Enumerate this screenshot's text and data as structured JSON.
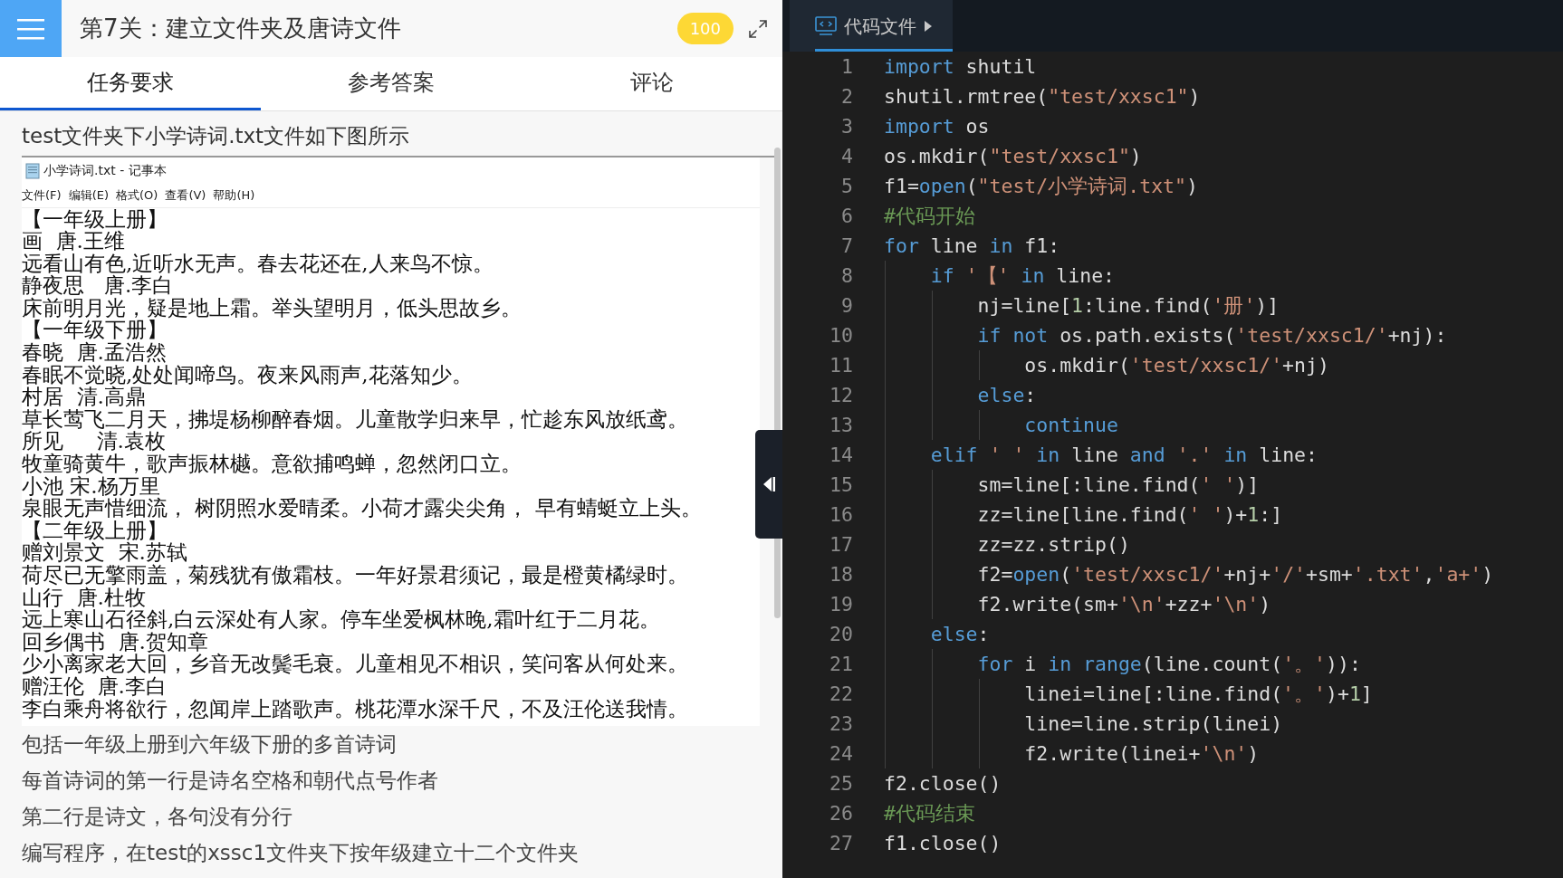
{
  "header": {
    "title": "第7关：建立文件夹及唐诗文件",
    "score": "100"
  },
  "tabs": [
    {
      "label": "任务要求",
      "selected": true
    },
    {
      "label": "参考答案",
      "selected": false
    },
    {
      "label": "评论",
      "selected": false
    }
  ],
  "content": {
    "heading": "test文件夹下小学诗词.txt文件如下图所示",
    "notepad": {
      "title": "小学诗词.txt - 记事本",
      "menu": [
        "文件(F)",
        "编辑(E)",
        "格式(O)",
        "查看(V)",
        "帮助(H)"
      ],
      "lines": [
        "【一年级上册】",
        "画  唐.王维",
        "远看山有色,近听水无声。春去花还在,人来鸟不惊。",
        "静夜思   唐.李白",
        "床前明月光，疑是地上霜。举头望明月，低头思故乡。",
        "【一年级下册】",
        "春晓  唐.孟浩然",
        "春眠不觉晓,处处闻啼鸟。夜来风雨声,花落知少。",
        "村居  清.高鼎",
        "草长莺飞二月天，拂堤杨柳醉春烟。儿童散学归来早，忙趁东风放纸鸢。",
        "所见     清.袁枚",
        "牧童骑黄牛，歌声振林樾。意欲捕鸣蝉，忽然闭口立。",
        "小池 宋.杨万里",
        "泉眼无声惜细流， 树阴照水爱晴柔。小荷才露尖尖角， 早有蜻蜓立上头。",
        "【二年级上册】",
        "赠刘景文  宋.苏轼",
        "荷尽已无擎雨盖，菊残犹有傲霜枝。一年好景君须记，最是橙黄橘绿时。",
        "山行  唐.杜牧",
        "远上寒山石径斜,白云深处有人家。停车坐爱枫林晚,霜叶红于二月花。",
        "回乡偶书  唐.贺知章",
        "少小离家老大回，乡音无改鬓毛衰。儿童相见不相识，笑问客从何处来。",
        "赠汪伦  唐.李白",
        "李白乘舟将欲行，忽闻岸上踏歌声。桃花潭水深千尺，不及汪伦送我情。"
      ]
    },
    "paragraphs": [
      "包括一年级上册到六年级下册的多首诗词",
      "每首诗词的第一行是诗名空格和朝代点号作者",
      "第二行是诗文，各句没有分行",
      "编写程序，在test的xssc1文件夹下按年级建立十二个文件夹"
    ]
  },
  "editor": {
    "tab": "代码文件",
    "lines": [
      {
        "number": "1",
        "tokens": [
          {
            "kind": "keyword",
            "text": "import"
          },
          {
            "kind": "plain",
            "text": " shutil"
          }
        ]
      },
      {
        "number": "2",
        "tokens": [
          {
            "kind": "plain",
            "text": "shutil.rmtree("
          },
          {
            "kind": "string",
            "text": "\"test/xxsc1\""
          },
          {
            "kind": "plain",
            "text": ")"
          }
        ]
      },
      {
        "number": "3",
        "tokens": [
          {
            "kind": "keyword",
            "text": "import"
          },
          {
            "kind": "plain",
            "text": " os"
          }
        ]
      },
      {
        "number": "4",
        "tokens": [
          {
            "kind": "plain",
            "text": "os.mkdir("
          },
          {
            "kind": "string",
            "text": "\"test/xxsc1\""
          },
          {
            "kind": "plain",
            "text": ")"
          }
        ]
      },
      {
        "number": "5",
        "tokens": [
          {
            "kind": "plain",
            "text": "f1="
          },
          {
            "kind": "keyword",
            "text": "open"
          },
          {
            "kind": "plain",
            "text": "("
          },
          {
            "kind": "string",
            "text": "\"test/小学诗词.txt\""
          },
          {
            "kind": "plain",
            "text": ")"
          }
        ]
      },
      {
        "number": "6",
        "tokens": [
          {
            "kind": "comment",
            "text": "#代码开始"
          }
        ]
      },
      {
        "number": "7",
        "tokens": [
          {
            "kind": "keyword",
            "text": "for"
          },
          {
            "kind": "plain",
            "text": " line "
          },
          {
            "kind": "keyword",
            "text": "in"
          },
          {
            "kind": "plain",
            "text": " f1:"
          }
        ]
      },
      {
        "number": "8",
        "tokens": [
          {
            "kind": "keyword",
            "text": "    if"
          },
          {
            "kind": "string",
            "text": " '【'"
          },
          {
            "kind": "keyword",
            "text": " in"
          },
          {
            "kind": "plain",
            "text": " line:"
          }
        ]
      },
      {
        "number": "9",
        "tokens": [
          {
            "kind": "plain",
            "text": "        nj=line["
          },
          {
            "kind": "number",
            "text": "1"
          },
          {
            "kind": "plain",
            "text": ":line.find("
          },
          {
            "kind": "string",
            "text": "'册'"
          },
          {
            "kind": "plain",
            "text": ")]"
          }
        ]
      },
      {
        "number": "10",
        "tokens": [
          {
            "kind": "keyword",
            "text": "        if"
          },
          {
            "kind": "keyword",
            "text": " not"
          },
          {
            "kind": "plain",
            "text": " os.path.exists("
          },
          {
            "kind": "string",
            "text": "'test/xxsc1/'"
          },
          {
            "kind": "plain",
            "text": "+nj):"
          }
        ]
      },
      {
        "number": "11",
        "tokens": [
          {
            "kind": "plain",
            "text": "            os.mkdir("
          },
          {
            "kind": "string",
            "text": "'test/xxsc1/'"
          },
          {
            "kind": "plain",
            "text": "+nj)"
          }
        ]
      },
      {
        "number": "12",
        "tokens": [
          {
            "kind": "keyword",
            "text": "        else"
          },
          {
            "kind": "plain",
            "text": ":"
          }
        ]
      },
      {
        "number": "13",
        "tokens": [
          {
            "kind": "keyword",
            "text": "            continue"
          }
        ]
      },
      {
        "number": "14",
        "tokens": [
          {
            "kind": "keyword",
            "text": "    elif"
          },
          {
            "kind": "string",
            "text": " ' '"
          },
          {
            "kind": "keyword",
            "text": " in"
          },
          {
            "kind": "plain",
            "text": " line "
          },
          {
            "kind": "keyword",
            "text": "and"
          },
          {
            "kind": "string",
            "text": " '.'"
          },
          {
            "kind": "keyword",
            "text": " in"
          },
          {
            "kind": "plain",
            "text": " line:"
          }
        ]
      },
      {
        "number": "15",
        "tokens": [
          {
            "kind": "plain",
            "text": "        sm=line[:line.find("
          },
          {
            "kind": "string",
            "text": "' '"
          },
          {
            "kind": "plain",
            "text": ")]"
          }
        ]
      },
      {
        "number": "16",
        "tokens": [
          {
            "kind": "plain",
            "text": "        zz=line[line.find("
          },
          {
            "kind": "string",
            "text": "' '"
          },
          {
            "kind": "plain",
            "text": ")+"
          },
          {
            "kind": "number",
            "text": "1"
          },
          {
            "kind": "plain",
            "text": ":]"
          }
        ]
      },
      {
        "number": "17",
        "tokens": [
          {
            "kind": "plain",
            "text": "        zz=zz.strip()"
          }
        ]
      },
      {
        "number": "18",
        "tokens": [
          {
            "kind": "plain",
            "text": "        f2="
          },
          {
            "kind": "keyword",
            "text": "open"
          },
          {
            "kind": "plain",
            "text": "("
          },
          {
            "kind": "string",
            "text": "'test/xxsc1/'"
          },
          {
            "kind": "plain",
            "text": "+nj+"
          },
          {
            "kind": "string",
            "text": "'/'"
          },
          {
            "kind": "plain",
            "text": "+sm+"
          },
          {
            "kind": "string",
            "text": "'.txt'"
          },
          {
            "kind": "plain",
            "text": ","
          },
          {
            "kind": "string",
            "text": "'a+'"
          },
          {
            "kind": "plain",
            "text": ")"
          }
        ]
      },
      {
        "number": "19",
        "tokens": [
          {
            "kind": "plain",
            "text": "        f2.write(sm+"
          },
          {
            "kind": "string",
            "text": "'\\n'"
          },
          {
            "kind": "plain",
            "text": "+zz+"
          },
          {
            "kind": "string",
            "text": "'\\n'"
          },
          {
            "kind": "plain",
            "text": ")"
          }
        ]
      },
      {
        "number": "20",
        "tokens": [
          {
            "kind": "keyword",
            "text": "    else"
          },
          {
            "kind": "plain",
            "text": ":"
          }
        ]
      },
      {
        "number": "21",
        "tokens": [
          {
            "kind": "keyword",
            "text": "        for"
          },
          {
            "kind": "plain",
            "text": " i "
          },
          {
            "kind": "keyword",
            "text": "in"
          },
          {
            "kind": "keyword",
            "text": " range"
          },
          {
            "kind": "plain",
            "text": "(line.count("
          },
          {
            "kind": "string",
            "text": "'。'"
          },
          {
            "kind": "plain",
            "text": ")):"
          }
        ]
      },
      {
        "number": "22",
        "tokens": [
          {
            "kind": "plain",
            "text": "            linei=line[:line.find("
          },
          {
            "kind": "string",
            "text": "'。'"
          },
          {
            "kind": "plain",
            "text": ")+"
          },
          {
            "kind": "number",
            "text": "1"
          },
          {
            "kind": "plain",
            "text": "]"
          }
        ]
      },
      {
        "number": "23",
        "tokens": [
          {
            "kind": "plain",
            "text": "            line=line.strip(linei)"
          }
        ]
      },
      {
        "number": "24",
        "tokens": [
          {
            "kind": "plain",
            "text": "            f2.write(linei+"
          },
          {
            "kind": "string",
            "text": "'\\n'"
          },
          {
            "kind": "plain",
            "text": ")"
          }
        ]
      },
      {
        "number": "25",
        "tokens": [
          {
            "kind": "plain",
            "text": "f2.close()"
          }
        ]
      },
      {
        "number": "26",
        "tokens": [
          {
            "kind": "comment",
            "text": "#代码结束"
          }
        ]
      },
      {
        "number": "27",
        "tokens": [
          {
            "kind": "plain",
            "text": "f1.close()"
          }
        ]
      }
    ]
  }
}
